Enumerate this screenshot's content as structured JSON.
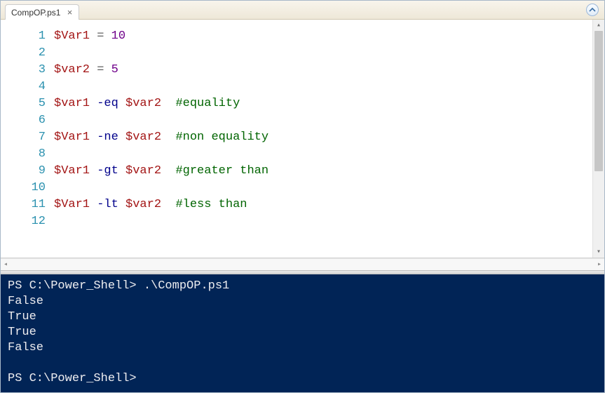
{
  "tab": {
    "title": "CompOP.ps1"
  },
  "editor": {
    "line_numbers": [
      "1",
      "2",
      "3",
      "4",
      "5",
      "6",
      "7",
      "8",
      "9",
      "10",
      "11",
      "12"
    ],
    "lines": [
      [
        {
          "cls": "tok-var",
          "t": "$Var1"
        },
        {
          "cls": "",
          "t": " "
        },
        {
          "cls": "tok-op",
          "t": "="
        },
        {
          "cls": "",
          "t": " "
        },
        {
          "cls": "tok-num",
          "t": "10"
        }
      ],
      [],
      [
        {
          "cls": "tok-var",
          "t": "$var2"
        },
        {
          "cls": "",
          "t": " "
        },
        {
          "cls": "tok-op",
          "t": "="
        },
        {
          "cls": "",
          "t": " "
        },
        {
          "cls": "tok-num",
          "t": "5"
        }
      ],
      [],
      [
        {
          "cls": "tok-var",
          "t": "$var1"
        },
        {
          "cls": "",
          "t": " "
        },
        {
          "cls": "tok-param",
          "t": "-eq"
        },
        {
          "cls": "",
          "t": " "
        },
        {
          "cls": "tok-var",
          "t": "$var2"
        },
        {
          "cls": "",
          "t": "  "
        },
        {
          "cls": "tok-comment",
          "t": "#equality"
        }
      ],
      [],
      [
        {
          "cls": "tok-var",
          "t": "$Var1"
        },
        {
          "cls": "",
          "t": " "
        },
        {
          "cls": "tok-param",
          "t": "-ne"
        },
        {
          "cls": "",
          "t": " "
        },
        {
          "cls": "tok-var",
          "t": "$var2"
        },
        {
          "cls": "",
          "t": "  "
        },
        {
          "cls": "tok-comment",
          "t": "#non equality"
        }
      ],
      [],
      [
        {
          "cls": "tok-var",
          "t": "$Var1"
        },
        {
          "cls": "",
          "t": " "
        },
        {
          "cls": "tok-param",
          "t": "-gt"
        },
        {
          "cls": "",
          "t": " "
        },
        {
          "cls": "tok-var",
          "t": "$var2"
        },
        {
          "cls": "",
          "t": "  "
        },
        {
          "cls": "tok-comment",
          "t": "#greater than"
        }
      ],
      [],
      [
        {
          "cls": "tok-var",
          "t": "$Var1"
        },
        {
          "cls": "",
          "t": " "
        },
        {
          "cls": "tok-param",
          "t": "-lt"
        },
        {
          "cls": "",
          "t": " "
        },
        {
          "cls": "tok-var",
          "t": "$var2"
        },
        {
          "cls": "",
          "t": "  "
        },
        {
          "cls": "tok-comment",
          "t": "#less than"
        }
      ],
      []
    ]
  },
  "terminal": {
    "lines": [
      "PS C:\\Power_Shell> .\\CompOP.ps1",
      "False",
      "True",
      "True",
      "False",
      "",
      "PS C:\\Power_Shell> "
    ]
  }
}
